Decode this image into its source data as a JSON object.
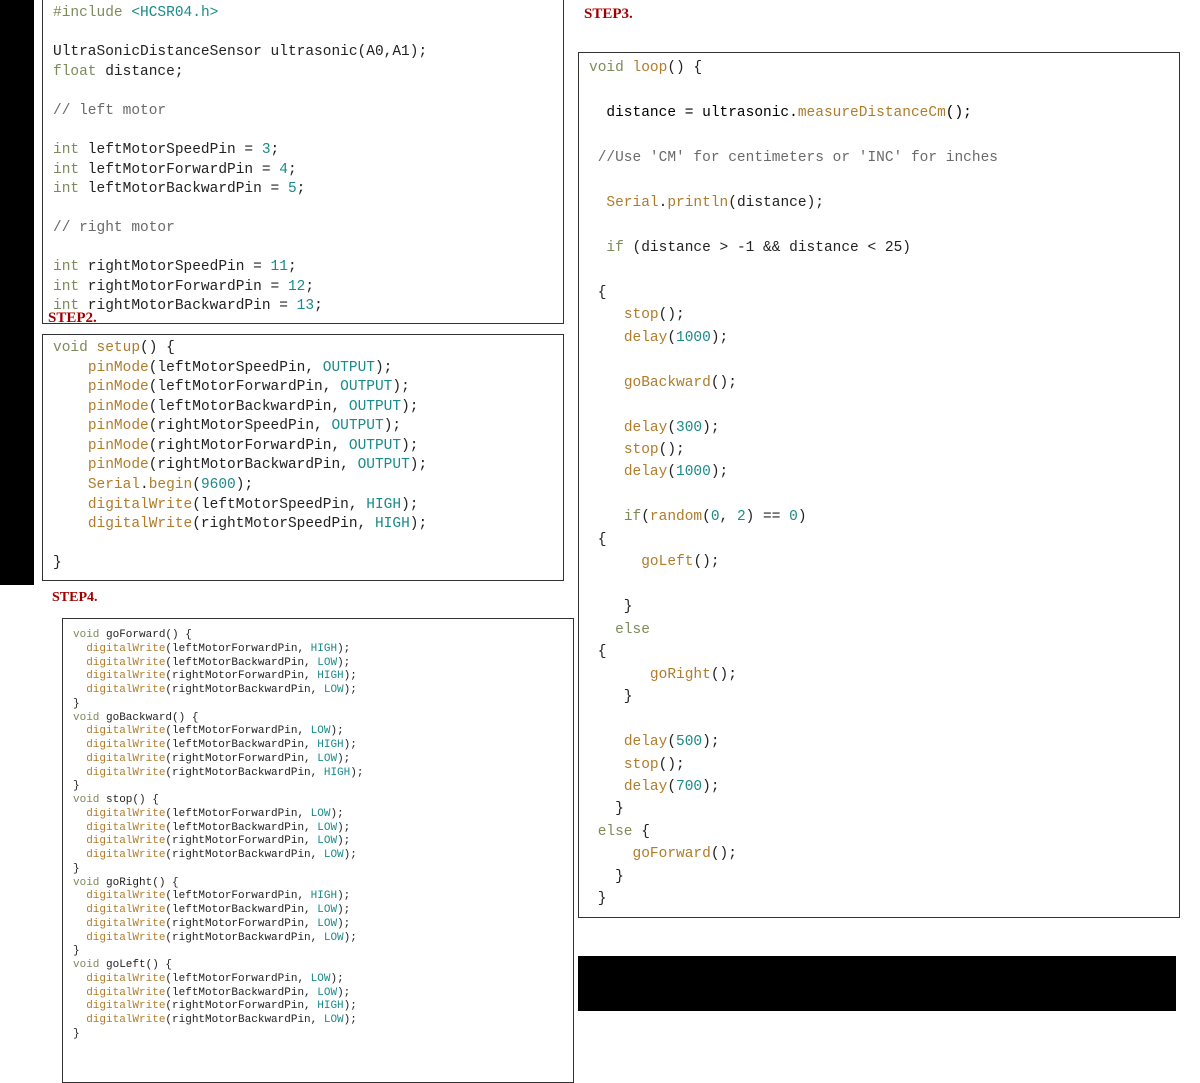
{
  "labels": {
    "step2": "STEP2.",
    "step3": "STEP3.",
    "step4": "STEP4."
  },
  "step1": {
    "l01a": "#include",
    "l01b": " <HCSR04.h>",
    "l03": "UltraSonicDistanceSensor ultrasonic(A0,A1);",
    "l04a": "float",
    "l04b": " distance;",
    "l06": "// left motor",
    "l08a": "int",
    "l08b": " leftMotorSpeedPin = ",
    "l08c": "3",
    "l08d": ";",
    "l09a": "int",
    "l09b": " leftMotorForwardPin = ",
    "l09c": "4",
    "l09d": ";",
    "l10a": "int",
    "l10b": " leftMotorBackwardPin = ",
    "l10c": "5",
    "l10d": ";",
    "l12": "// right motor",
    "l14a": "int",
    "l14b": " rightMotorSpeedPin = ",
    "l14c": "11",
    "l14d": ";",
    "l15a": "int",
    "l15b": " rightMotorForwardPin = ",
    "l15c": "12",
    "l15d": ";",
    "l16a": "int",
    "l16b": " rightMotorBackwardPin = ",
    "l16c": "13",
    "l16d": ";"
  },
  "step2": {
    "l01a": "void",
    "l01b": "setup",
    "l01c": "() {",
    "l02a": "    ",
    "l02b": "pinMode",
    "l02c": "(leftMotorSpeedPin, ",
    "l02d": "OUTPUT",
    "l02e": ");",
    "l03a": "    ",
    "l03b": "pinMode",
    "l03c": "(leftMotorForwardPin, ",
    "l03d": "OUTPUT",
    "l03e": ");",
    "l04a": "    ",
    "l04b": "pinMode",
    "l04c": "(leftMotorBackwardPin, ",
    "l04d": "OUTPUT",
    "l04e": ");",
    "l05a": "    ",
    "l05b": "pinMode",
    "l05c": "(rightMotorSpeedPin, ",
    "l05d": "OUTPUT",
    "l05e": ");",
    "l06a": "    ",
    "l06b": "pinMode",
    "l06c": "(rightMotorForwardPin, ",
    "l06d": "OUTPUT",
    "l06e": ");",
    "l07a": "    ",
    "l07b": "pinMode",
    "l07c": "(rightMotorBackwardPin, ",
    "l07d": "OUTPUT",
    "l07e": ");",
    "l08a": "    ",
    "l08b": "Serial",
    "l08c": ".",
    "l08d": "begin",
    "l08e": "(",
    "l08f": "9600",
    "l08g": ");",
    "l09a": "    ",
    "l09b": "digitalWrite",
    "l09c": "(leftMotorSpeedPin, ",
    "l09d": "HIGH",
    "l09e": ");",
    "l10a": "    ",
    "l10b": "digitalWrite",
    "l10c": "(rightMotorSpeedPin, ",
    "l10d": "HIGH",
    "l10e": ");",
    "l12": "}"
  },
  "step3": {
    "l01a": "void",
    "l01b": "loop",
    "l01c": "() {",
    "l03": "  distance = ultrasonic.measureDistanceCm();",
    "l03x": "measureDistanceCm",
    "l05": " //Use 'CM' for centimeters or 'INC' for inches",
    "l07a": "  ",
    "l07b": "Serial",
    "l07c": ".",
    "l07d": "println",
    "l07e": "(distance);",
    "l09a": "  ",
    "l09b": "if",
    "l09c": " (distance > ",
    "l09d": "-1",
    "l09e": " && distance < ",
    "l09f": "25",
    "l09g": ")",
    "l11": " {",
    "l12a": "    ",
    "l12b": "stop",
    "l12c": "();",
    "l13a": "    ",
    "l13b": "delay",
    "l13c": "(",
    "l13d": "1000",
    "l13e": ");",
    "l15a": "    ",
    "l15b": "goBackward",
    "l15c": "();",
    "l17a": "    ",
    "l17b": "delay",
    "l17c": "(",
    "l17d": "300",
    "l17e": ");",
    "l18a": "    ",
    "l18b": "stop",
    "l18c": "();",
    "l19a": "    ",
    "l19b": "delay",
    "l19c": "(",
    "l19d": "1000",
    "l19e": ");",
    "l21a": "    ",
    "l21b": "if",
    "l21c": "(",
    "l21d": "random",
    "l21e": "(",
    "l21f": "0",
    "l21g": ", ",
    "l21h": "2",
    "l21i": ") == ",
    "l21j": "0",
    "l21k": ")",
    "l22": " {",
    "l23a": "      ",
    "l23b": "goLeft",
    "l23c": "();",
    "l25": "    }",
    "l26a": "   ",
    "l26b": "else",
    "l27": " {",
    "l28a": "       ",
    "l28b": "goRight",
    "l28c": "();",
    "l29": "    }",
    "l31a": "    ",
    "l31b": "delay",
    "l31c": "(",
    "l31d": "500",
    "l31e": ");",
    "l32a": "    ",
    "l32b": "stop",
    "l32c": "();",
    "l33a": "    ",
    "l33b": "delay",
    "l33c": "(",
    "l33d": "700",
    "l33e": ");",
    "l34": "   }",
    "l35a": " ",
    "l35b": "else",
    "l35c": " {",
    "l36a": "     ",
    "l36b": "goForward",
    "l36c": "();",
    "l37": "   }",
    "l38": " }"
  },
  "step4": {
    "l01a": "void",
    "l01b": " goForward() {",
    "l02a": "  ",
    "l02b": "digitalWrite",
    "l02c": "(leftMotorForwardPin, ",
    "l02d": "HIGH",
    "l02e": ");",
    "l03a": "  ",
    "l03b": "digitalWrite",
    "l03c": "(leftMotorBackwardPin, ",
    "l03d": "LOW",
    "l03e": ");",
    "l04a": "  ",
    "l04b": "digitalWrite",
    "l04c": "(rightMotorForwardPin, ",
    "l04d": "HIGH",
    "l04e": ");",
    "l05a": "  ",
    "l05b": "digitalWrite",
    "l05c": "(rightMotorBackwardPin, ",
    "l05d": "LOW",
    "l05e": ");",
    "l06": "}",
    "l07a": "void",
    "l07b": " goBackward() {",
    "l08a": "  ",
    "l08b": "digitalWrite",
    "l08c": "(leftMotorForwardPin, ",
    "l08d": "LOW",
    "l08e": ");",
    "l09a": "  ",
    "l09b": "digitalWrite",
    "l09c": "(leftMotorBackwardPin, ",
    "l09d": "HIGH",
    "l09e": ");",
    "l10a": "  ",
    "l10b": "digitalWrite",
    "l10c": "(rightMotorForwardPin, ",
    "l10d": "LOW",
    "l10e": ");",
    "l11a": "  ",
    "l11b": "digitalWrite",
    "l11c": "(rightMotorBackwardPin, ",
    "l11d": "HIGH",
    "l11e": ");",
    "l12": "}",
    "l13a": "void",
    "l13b": " stop() {",
    "l14a": "  ",
    "l14b": "digitalWrite",
    "l14c": "(leftMotorForwardPin, ",
    "l14d": "LOW",
    "l14e": ");",
    "l15a": "  ",
    "l15b": "digitalWrite",
    "l15c": "(leftMotorBackwardPin, ",
    "l15d": "LOW",
    "l15e": ");",
    "l16a": "  ",
    "l16b": "digitalWrite",
    "l16c": "(rightMotorForwardPin, ",
    "l16d": "LOW",
    "l16e": ");",
    "l17a": "  ",
    "l17b": "digitalWrite",
    "l17c": "(rightMotorBackwardPin, ",
    "l17d": "LOW",
    "l17e": ");",
    "l18": "}",
    "l19a": "void",
    "l19b": " goRight() {",
    "l20a": "  ",
    "l20b": "digitalWrite",
    "l20c": "(leftMotorForwardPin, ",
    "l20d": "HIGH",
    "l20e": ");",
    "l21a": "  ",
    "l21b": "digitalWrite",
    "l21c": "(leftMotorBackwardPin, ",
    "l21d": "LOW",
    "l21e": ");",
    "l22a": "  ",
    "l22b": "digitalWrite",
    "l22c": "(rightMotorForwardPin, ",
    "l22d": "LOW",
    "l22e": ");",
    "l23a": "  ",
    "l23b": "digitalWrite",
    "l23c": "(rightMotorBackwardPin, ",
    "l23d": "LOW",
    "l23e": ");",
    "l24": "}",
    "l25a": "void",
    "l25b": " goLeft() {",
    "l26a": "  ",
    "l26b": "digitalWrite",
    "l26c": "(leftMotorForwardPin, ",
    "l26d": "LOW",
    "l26e": ");",
    "l27a": "  ",
    "l27b": "digitalWrite",
    "l27c": "(leftMotorBackwardPin, ",
    "l27d": "LOW",
    "l27e": ");",
    "l28a": "  ",
    "l28b": "digitalWrite",
    "l28c": "(rightMotorForwardPin, ",
    "l28d": "HIGH",
    "l28e": ");",
    "l29a": "  ",
    "l29b": "digitalWrite",
    "l29c": "(rightMotorBackwardPin, ",
    "l29d": "LOW",
    "l29e": ");",
    "l30": "}"
  }
}
